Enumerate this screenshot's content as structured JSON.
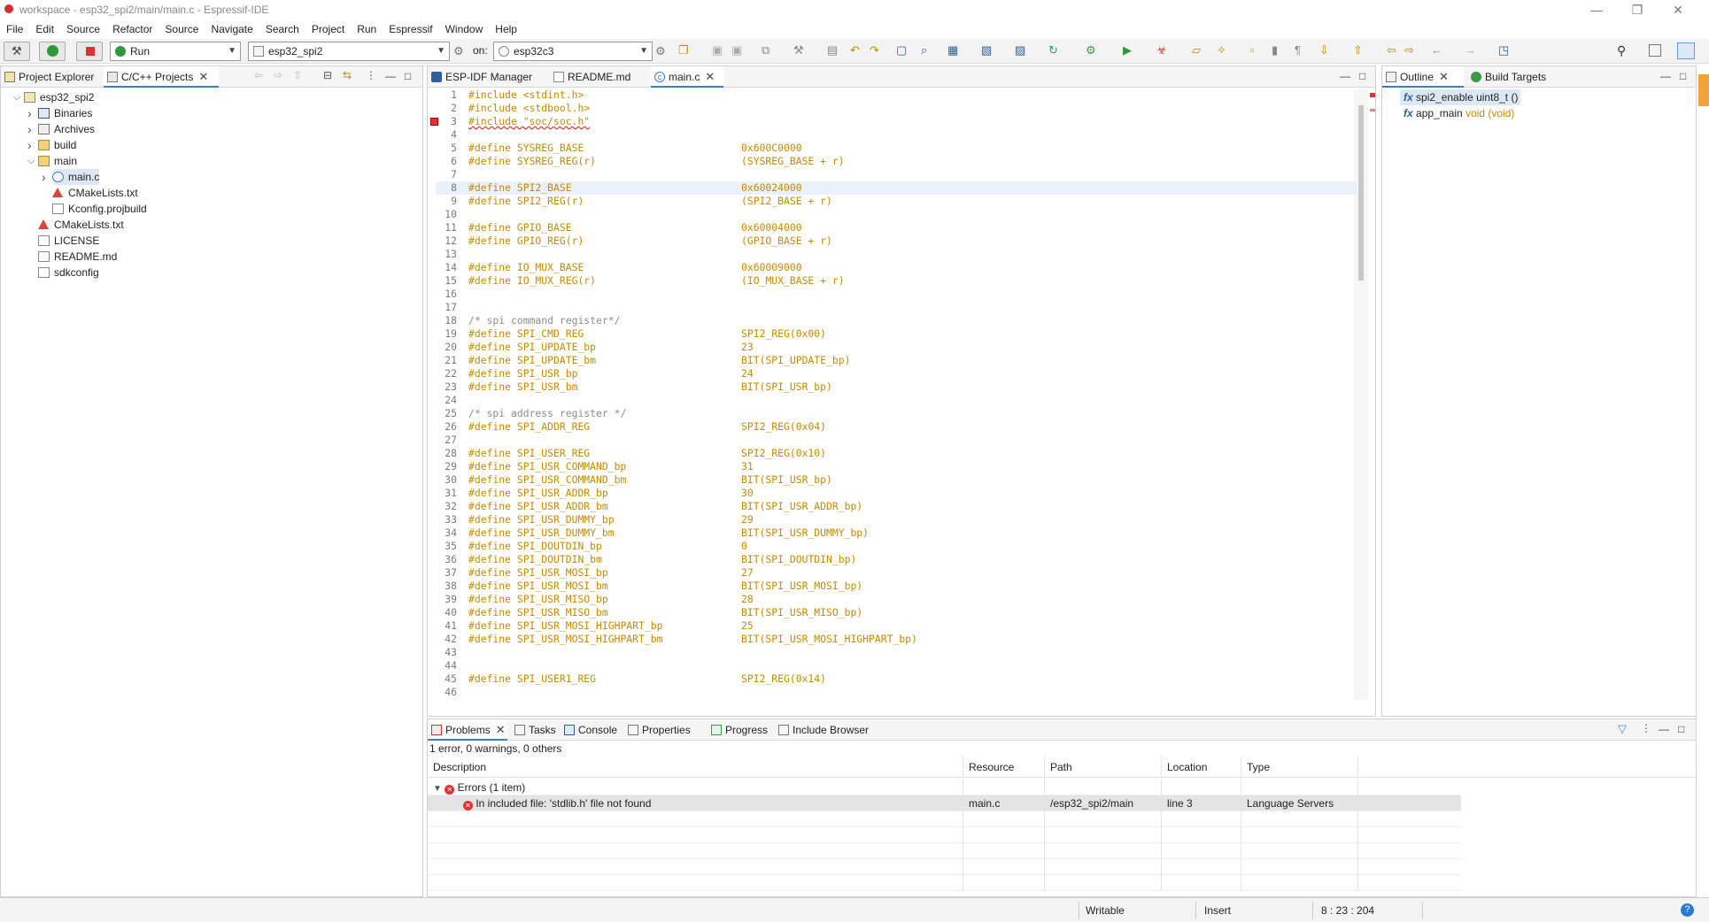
{
  "window": {
    "title": "workspace - esp32_spi2/main/main.c - Espressif-IDE"
  },
  "menu": [
    "File",
    "Edit",
    "Source",
    "Refactor",
    "Source",
    "Navigate",
    "Search",
    "Project",
    "Run",
    "Espressif",
    "Window",
    "Help"
  ],
  "toolbar": {
    "launch_mode": "Run",
    "launch_config": "esp32_spi2",
    "on_label": "on:",
    "target": "esp32c3"
  },
  "left_panel": {
    "tabs": [
      "Project Explorer",
      "C/C++ Projects"
    ],
    "tree": [
      {
        "label": "esp32_spi2",
        "icon": "project-icon",
        "depth": 0,
        "expanded": true
      },
      {
        "label": "Binaries",
        "icon": "binaries-icon",
        "depth": 1,
        "expanded": false
      },
      {
        "label": "Archives",
        "icon": "archives-icon",
        "depth": 1,
        "expanded": false
      },
      {
        "label": "build",
        "icon": "folder-icon",
        "depth": 1,
        "expanded": false
      },
      {
        "label": "main",
        "icon": "folder-icon",
        "depth": 1,
        "expanded": true
      },
      {
        "label": "main.c",
        "icon": "c-file-icon",
        "depth": 2,
        "expanded": false,
        "selected": true
      },
      {
        "label": "CMakeLists.txt",
        "icon": "cmake-icon",
        "depth": 2
      },
      {
        "label": "Kconfig.projbuild",
        "icon": "file-icon",
        "depth": 2
      },
      {
        "label": "CMakeLists.txt",
        "icon": "cmake-icon",
        "depth": 1
      },
      {
        "label": "LICENSE",
        "icon": "file-icon",
        "depth": 1
      },
      {
        "label": "README.md",
        "icon": "file-icon",
        "depth": 1
      },
      {
        "label": "sdkconfig",
        "icon": "file-icon",
        "depth": 1
      }
    ]
  },
  "editor": {
    "tabs": [
      "ESP-IDF Manager",
      "README.md",
      "main.c"
    ],
    "active_tab": "main.c",
    "lines": [
      [
        "1",
        "#include <stdint.h>",
        ""
      ],
      [
        "2",
        "#include <stdbool.h>",
        ""
      ],
      [
        "3",
        "#include \"soc/soc.h\"",
        ""
      ],
      [
        "4",
        "",
        ""
      ],
      [
        "5",
        "#define SYSREG_BASE",
        "0x600C0000"
      ],
      [
        "6",
        "#define SYSREG_REG(r)",
        "(SYSREG_BASE + r)"
      ],
      [
        "7",
        "",
        ""
      ],
      [
        "8",
        "#define SPI2_BASE",
        "0x60024000"
      ],
      [
        "9",
        "#define SPI2_REG(r)",
        "(SPI2_BASE + r)"
      ],
      [
        "10",
        "",
        ""
      ],
      [
        "11",
        "#define GPIO_BASE",
        "0x60004000"
      ],
      [
        "12",
        "#define GPIO_REG(r)",
        "(GPIO_BASE + r)"
      ],
      [
        "13",
        "",
        ""
      ],
      [
        "14",
        "#define IO_MUX_BASE",
        "0x60009000"
      ],
      [
        "15",
        "#define IO_MUX_REG(r)",
        "(IO_MUX_BASE + r)"
      ],
      [
        "16",
        "",
        ""
      ],
      [
        "17",
        "",
        ""
      ],
      [
        "18",
        "/* spi command register*/",
        ""
      ],
      [
        "19",
        "#define SPI_CMD_REG",
        "SPI2_REG(0x00)"
      ],
      [
        "20",
        "#define SPI_UPDATE_bp",
        "23"
      ],
      [
        "21",
        "#define SPI_UPDATE_bm",
        "BIT(SPI_UPDATE_bp)"
      ],
      [
        "22",
        "#define SPI_USR_bp",
        "24"
      ],
      [
        "23",
        "#define SPI_USR_bm",
        "BIT(SPI_USR_bp)"
      ],
      [
        "24",
        "",
        ""
      ],
      [
        "25",
        "/* spi address register */",
        ""
      ],
      [
        "26",
        "#define SPI_ADDR_REG",
        "SPI2_REG(0x04)"
      ],
      [
        "27",
        "",
        ""
      ],
      [
        "28",
        "#define SPI_USER_REG",
        "SPI2_REG(0x10)"
      ],
      [
        "29",
        "#define SPI_USR_COMMAND_bp",
        "31"
      ],
      [
        "30",
        "#define SPI_USR_COMMAND_bm",
        "BIT(SPI_USR_bp)"
      ],
      [
        "31",
        "#define SPI_USR_ADDR_bp",
        "30"
      ],
      [
        "32",
        "#define SPI_USR_ADDR_bm",
        "BIT(SPI_USR_ADDR_bp)"
      ],
      [
        "33",
        "#define SPI_USR_DUMMY_bp",
        "29"
      ],
      [
        "34",
        "#define SPI_USR_DUMMY_bm",
        "BIT(SPI_USR_DUMMY_bp)"
      ],
      [
        "35",
        "#define SPI_DOUTDIN_bp",
        "0"
      ],
      [
        "36",
        "#define SPI_DOUTDIN_bm",
        "BIT(SPI_DOUTDIN_bp)"
      ],
      [
        "37",
        "#define SPI_USR_MOSI_bp",
        "27"
      ],
      [
        "38",
        "#define SPI_USR_MOSI_bm",
        "BIT(SPI_USR_MOSI_bp)"
      ],
      [
        "39",
        "#define SPI_USR_MISO_bp",
        "28"
      ],
      [
        "40",
        "#define SPI_USR_MISO_bm",
        "BIT(SPI_USR_MISO_bp)"
      ],
      [
        "41",
        "#define SPI_USR_MOSI_HIGHPART_bp",
        "25"
      ],
      [
        "42",
        "#define SPI_USR_MOSI_HIGHPART_bm",
        "BIT(SPI_USR_MOSI_HIGHPART_bp)"
      ],
      [
        "43",
        "",
        ""
      ],
      [
        "44",
        "",
        ""
      ],
      [
        "45",
        "#define SPI_USER1_REG",
        "SPI2_REG(0x14)"
      ],
      [
        "46",
        "",
        ""
      ]
    ],
    "highlight_line": "8",
    "error_line": "3"
  },
  "outline": {
    "tabs": [
      "Outline",
      "Build Targets"
    ],
    "items": [
      {
        "name": "spi2_enable",
        "sig": "uint8_t ()"
      },
      {
        "name": "app_main",
        "sig": "void (void)"
      }
    ]
  },
  "problems": {
    "tabs": [
      "Problems",
      "Tasks",
      "Console",
      "Properties",
      "Progress",
      "Include Browser"
    ],
    "summary": "1 error, 0 warnings, 0 others",
    "columns": [
      "Description",
      "Resource",
      "Path",
      "Location",
      "Type"
    ],
    "group": "Errors (1 item)",
    "rows": [
      {
        "description": "In included file: 'stdlib.h' file not found",
        "resource": "main.c",
        "path": "/esp32_spi2/main",
        "location": "line 3",
        "type": "Language Servers"
      }
    ]
  },
  "status": {
    "writable": "Writable",
    "insert": "Insert",
    "position": "8 : 23 : 204"
  },
  "colors": {
    "accent": "#3b7bd4",
    "macro": "#c28b00",
    "error": "#d33333"
  }
}
